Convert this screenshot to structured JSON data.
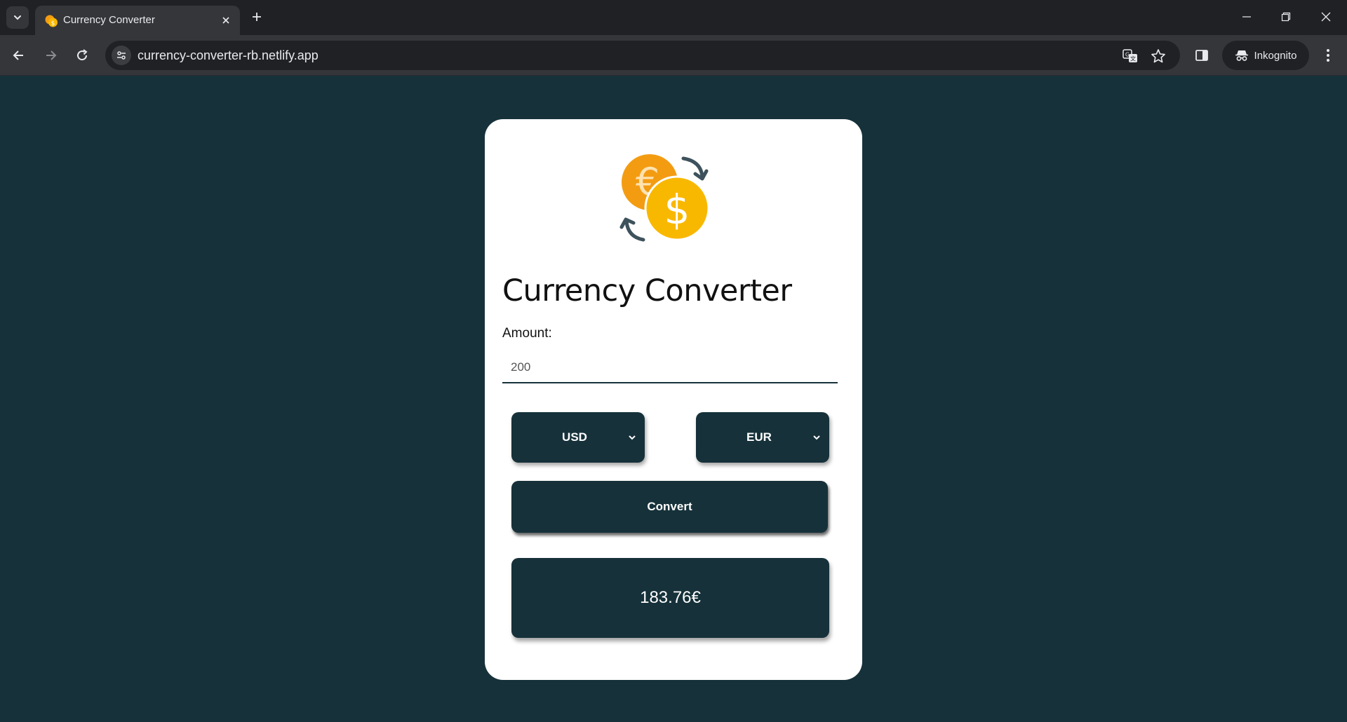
{
  "browser": {
    "tab_title": "Currency Converter",
    "url": "currency-converter-rb.netlify.app",
    "profile_label": "Inkognito"
  },
  "app": {
    "title": "Currency Converter",
    "amount_label": "Amount:",
    "amount_value": "200",
    "from_currency": "USD",
    "to_currency": "EUR",
    "convert_label": "Convert",
    "result": "183.76€",
    "logo_icon": "currency-exchange-icon"
  },
  "colors": {
    "page_background": "#16313a",
    "card_background": "#ffffff",
    "control_background": "#16313a",
    "euro_coin": "#f39c12",
    "dollar_coin": "#f9b800",
    "exchange_arrows": "#3d525c"
  }
}
